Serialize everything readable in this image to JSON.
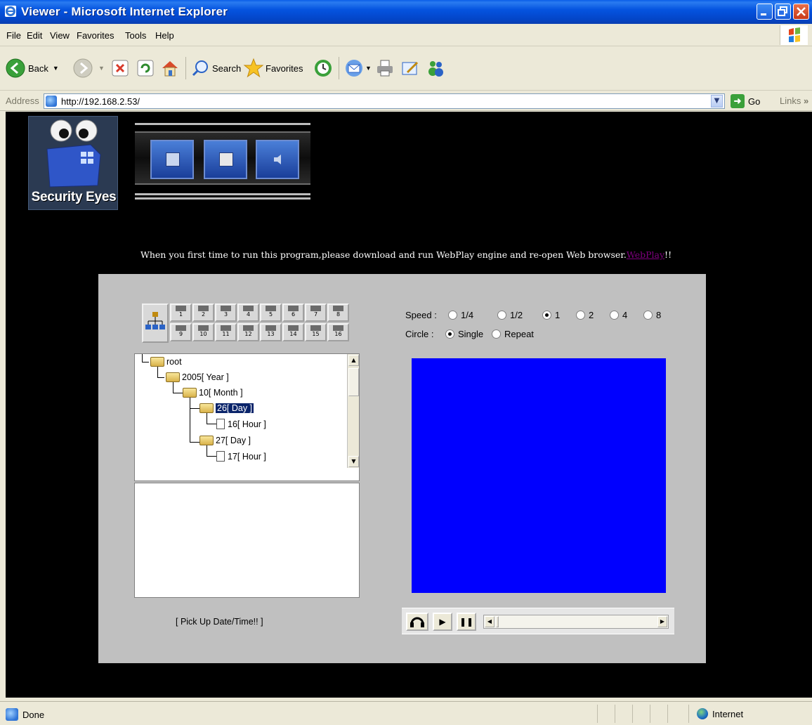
{
  "window": {
    "title": "Viewer - Microsoft Internet Explorer"
  },
  "menu": {
    "items": [
      "File",
      "Edit",
      "View",
      "Favorites",
      "Tools",
      "Help"
    ]
  },
  "toolbar": {
    "back_label": "Back",
    "search_label": "Search",
    "favorites_label": "Favorites"
  },
  "address": {
    "label": "Address",
    "url": "http://192.168.2.53/",
    "go_label": "Go",
    "links_label": "Links"
  },
  "page": {
    "brand": "Security Eyes",
    "notice_text": "When you first time to run this program,please download and run WebPlay engine and re-open Web browser.",
    "notice_link": "WebPlay",
    "notice_suffix": "!!",
    "cameras": [
      "1",
      "2",
      "3",
      "4",
      "5",
      "6",
      "7",
      "8",
      "9",
      "10",
      "11",
      "12",
      "13",
      "14",
      "15",
      "16"
    ],
    "tree": {
      "root": "root",
      "year": "2005[ Year ]",
      "month": "10[ Month ]",
      "day1": "26[ Day ]",
      "hour1": "16[ Hour ]",
      "day2": "27[ Day ]",
      "hour2": "17[ Hour ]"
    },
    "pickup_label": "[ Pick Up Date/Time!! ]",
    "speed": {
      "label": "Speed :",
      "options": [
        "1/4",
        "1/2",
        "1",
        "2",
        "4",
        "8"
      ],
      "selected": "1"
    },
    "circle": {
      "label": "Circle :",
      "options": [
        "Single",
        "Repeat"
      ],
      "selected": "Single"
    },
    "playback": {
      "seek_position": 0.0
    }
  },
  "status": {
    "left": "Done",
    "zone": "Internet"
  },
  "colors": {
    "video_bg": "#0000ff",
    "panel_bg": "#c0c0c0",
    "page_bg": "#000000",
    "title_bar": "#0554e0"
  }
}
